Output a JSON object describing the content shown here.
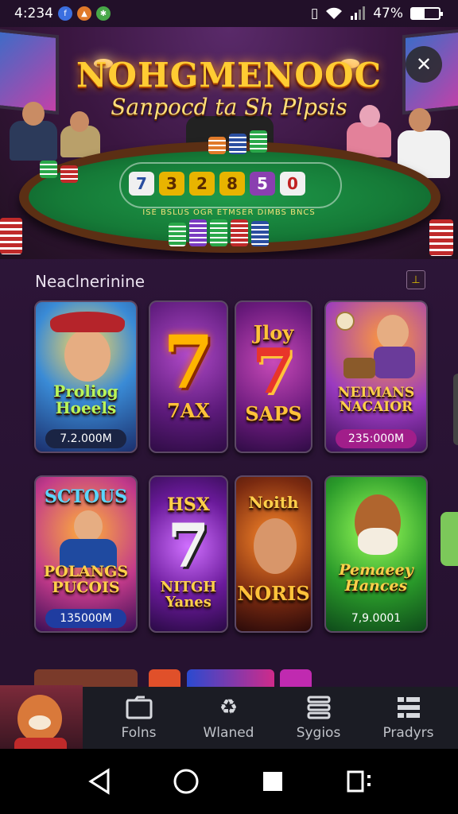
{
  "status_bar": {
    "time": "4:234",
    "battery_text": "47%",
    "battery_level": 0.47,
    "icons": [
      "facebook-icon",
      "gallery-icon",
      "settings-icon",
      "vibrate-icon",
      "wifi-icon",
      "signal-icon"
    ]
  },
  "hero": {
    "title": "NOHGMENOOC",
    "subtitle": "Sanpocd ta Sh Plpsis",
    "close_icon": "close-icon",
    "felt_text": "ISE BSLUS OGR ETMSER DIMBS BNCS"
  },
  "section": {
    "title": "Neaclnerinine",
    "action_icon": "bookmark-icon"
  },
  "games_row1": [
    {
      "name": "Proliog Hoeels",
      "value": "7.2.000M"
    },
    {
      "name": "7AX"
    },
    {
      "name_top": "Jloy",
      "name": "SAPS"
    },
    {
      "name": "NEIMANS NACAIOR",
      "value": "235:000M"
    }
  ],
  "games_row2": [
    {
      "name_top": "SCTOUS",
      "name": "POLANGS PUCOIS",
      "value": "135000M"
    },
    {
      "name_top": "HSX",
      "name": "NITGH Yanes"
    },
    {
      "name_top": "Noith",
      "name": "NORIS"
    },
    {
      "name": "Pemaeey Hances",
      "value": "7,9.0001"
    }
  ],
  "bottom_nav": [
    {
      "label": "Folns",
      "icon": "folder-icon"
    },
    {
      "label": "Wlaned",
      "icon": "recycle-icon"
    },
    {
      "label": "Sygios",
      "icon": "stack-icon"
    },
    {
      "label": "Pradyrs",
      "icon": "list-icon"
    }
  ],
  "colors": {
    "background": "#2b1436",
    "felt": "#157a37",
    "accent_gold": "#ffcc33",
    "nav_bg": "#1b1c24"
  }
}
